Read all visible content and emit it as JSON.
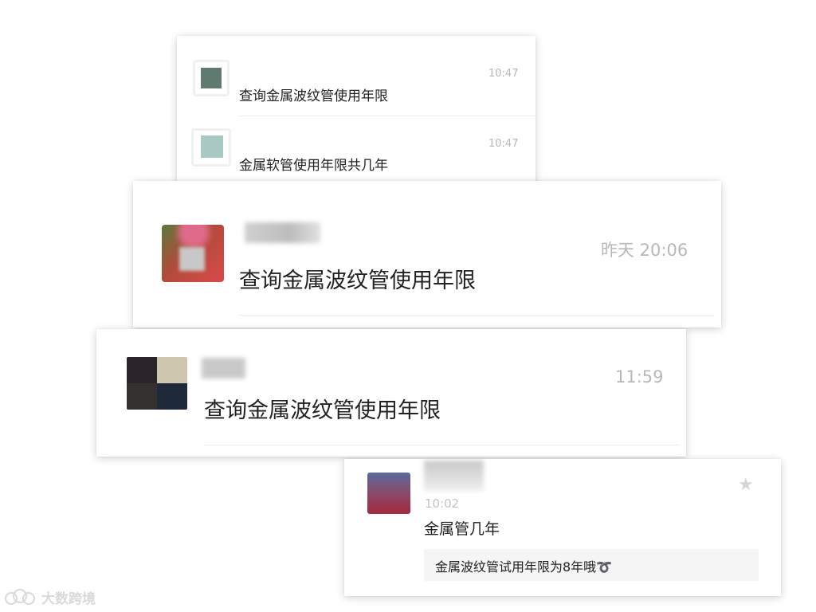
{
  "card1": {
    "rows": [
      {
        "time": "10:47",
        "message": "查询金属波纹管使用年限"
      },
      {
        "time": "10:47",
        "message": "金属软管使用年限共几年"
      }
    ]
  },
  "card2": {
    "time": "昨天 20:06",
    "message": "查询金属波纹管使用年限"
  },
  "card3": {
    "time": "11:59",
    "message": "查询金属波纹管使用年限"
  },
  "card4": {
    "time": "10:02",
    "message": "金属管几年",
    "reply": "金属波纹管试用年限为8年哦➰",
    "star_icon": "star-icon"
  },
  "watermark": {
    "text": "大数跨境"
  }
}
